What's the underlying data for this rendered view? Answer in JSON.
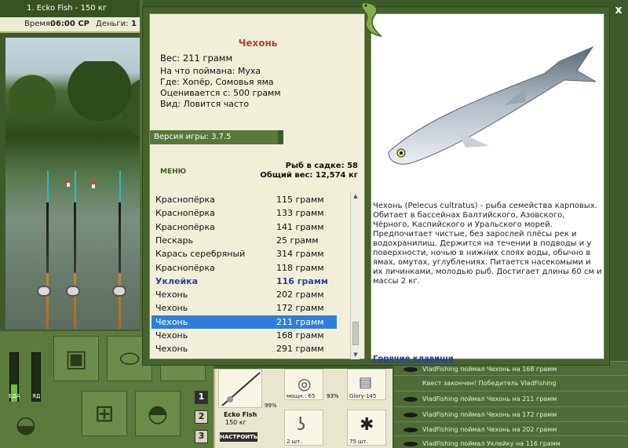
{
  "topbar": {
    "title": "1. Ecko Fish - 150 кг",
    "time_label": "Время:",
    "time_value": "06:00 СР",
    "money_label": "Деньги:",
    "money_value": "1"
  },
  "gauges": {
    "left_label": "ЕДА",
    "right_label": "ЯД",
    "left_fill": 0.42,
    "right_fill": 0.0
  },
  "pager": [
    "1",
    "2",
    "3"
  ],
  "popup": {
    "fish_name": "Чехонь",
    "weight_line": "Вес: 211 грамм",
    "caught_on": "На что поймана: Муха",
    "where": "Где: Хопёр, Сомовья яма",
    "valued_at": "Оценивается с: 500 грамм",
    "kind": "Вид: Ловится часто",
    "version": "Версия игры: 3.7.5",
    "menu_label": "МЕНЮ",
    "keepnet": "Рыб в садке: 58",
    "total_weight": "Общий вес: 12,574 кг",
    "description": "Чехонь (Pelecus cultratus) - рыба семейства карповых. Обитает в бассейнах Балтийского, Азовского, Чёрного, Каспийского и Уральского морей. Предпочитает чистые, без зарослей плёсы рек и водохранилищ. Держится на течении в подводы и у поверхности, ночью в нижних слоях воды, обычно в ямах, омутах, углублениях. Питается насекомыми и их личинками, молодью рыб. Достигает длины 60 см и массы 2 кг.",
    "hotkeys": "Горячие клавиши",
    "catch_list": [
      {
        "name": "Краснопёрка",
        "weight": "115 грамм",
        "style": "normal"
      },
      {
        "name": "Краснопёрка",
        "weight": "133 грамм",
        "style": "normal"
      },
      {
        "name": "Краснопёрка",
        "weight": "141 грамм",
        "style": "normal"
      },
      {
        "name": "Пескарь",
        "weight": "25 грамм",
        "style": "normal"
      },
      {
        "name": "Карась серебряный",
        "weight": "314 грамм",
        "style": "normal"
      },
      {
        "name": "Краснопёрка",
        "weight": "118 грамм",
        "style": "normal"
      },
      {
        "name": "Уклейка",
        "weight": "116 грамм",
        "style": "bold"
      },
      {
        "name": "Чехонь",
        "weight": "202 грамм",
        "style": "normal"
      },
      {
        "name": "Чехонь",
        "weight": "172 грамм",
        "style": "normal"
      },
      {
        "name": "Чехонь",
        "weight": "211 грамм",
        "style": "selected"
      },
      {
        "name": "Чехонь",
        "weight": "168 грамм",
        "style": "normal"
      },
      {
        "name": "Чехонь",
        "weight": "291 грамм",
        "style": "normal"
      }
    ]
  },
  "equipment": {
    "rod_name": "Ecko Fish",
    "rod_weight": "150 кг",
    "setup_button": "НАСТРОИТЬ",
    "rod_condition": "99%",
    "reel_caption": "мощн.: 65",
    "reel_condition": "93%",
    "line_caption": "Glory-145",
    "hook_caption": "2 шт.",
    "bait_caption": "75 шт."
  },
  "chat": [
    "VladFishing поймал Чехонь на 168 грамм",
    "Квест закончен! Победитель VladFishing",
    "VladFishing поймал Чехонь на 211 грамм",
    "VladFishing поймал Чехонь на 172 грамм",
    "VladFishing поймал Чехонь на 202 грамм",
    "VladFishing поймал Уклейку на 116 грамм"
  ],
  "close_label": "x"
}
